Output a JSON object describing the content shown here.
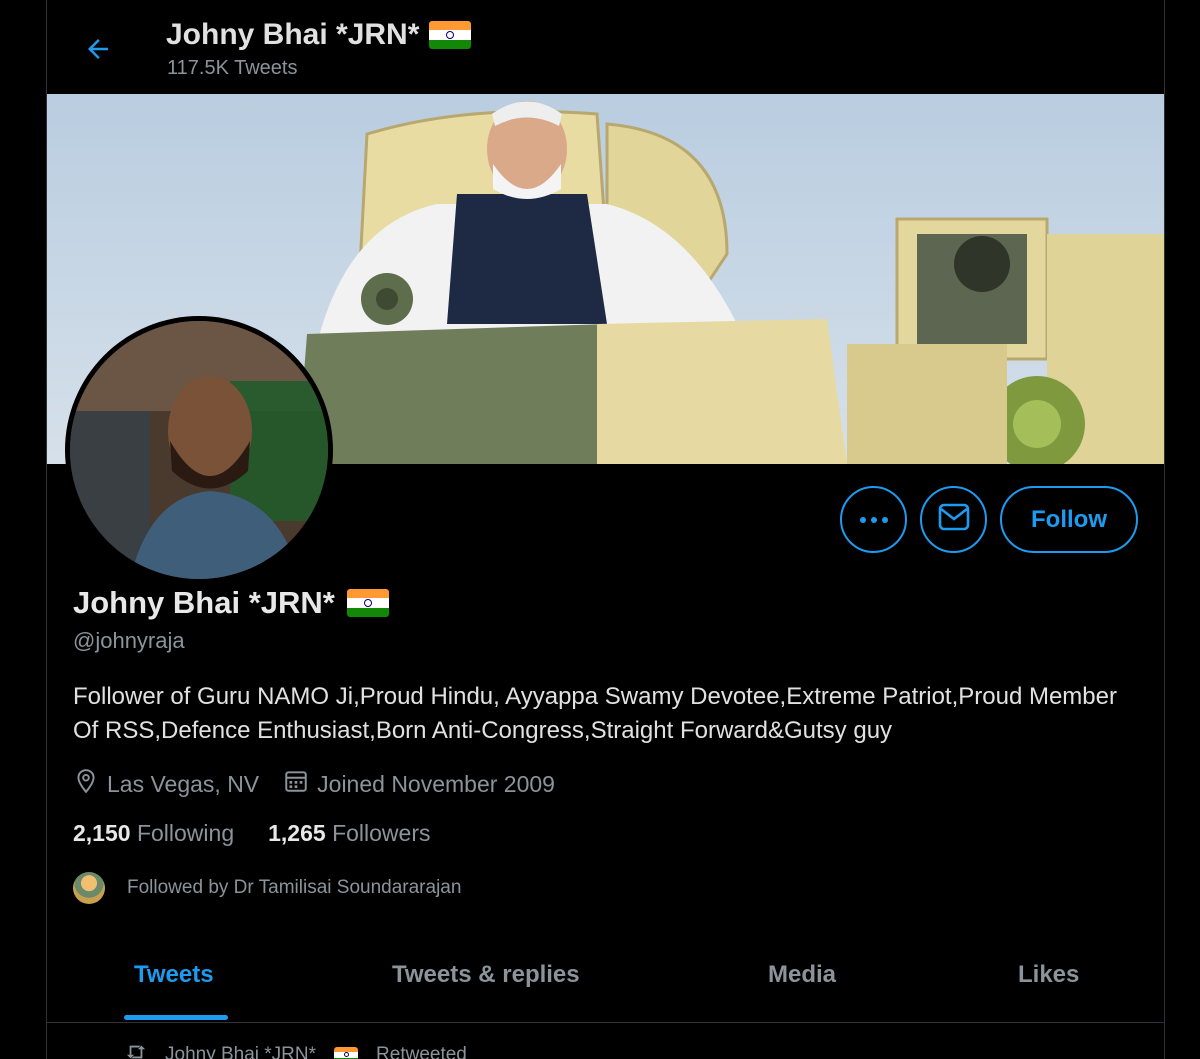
{
  "header": {
    "display_name": "Johny Bhai *JRN*",
    "tweet_count": "117.5K Tweets"
  },
  "profile": {
    "display_name": "Johny Bhai *JRN*",
    "handle": "@johnyraja",
    "bio": "Follower of Guru NAMO Ji,Proud Hindu, Ayyappa Swamy Devotee,Extreme Patriot,Proud Member Of RSS,Defence Enthusiast,Born Anti-Congress,Straight Forward&Gutsy guy",
    "location": "Las Vegas, NV",
    "joined": "Joined November 2009",
    "following_count": "2,150",
    "following_label": "Following",
    "followers_count": "1,265",
    "followers_label": "Followers",
    "followed_by": "Followed by Dr Tamilisai Soundararajan"
  },
  "actions": {
    "follow_label": "Follow"
  },
  "tabs": [
    {
      "label": "Tweets",
      "active": true
    },
    {
      "label": "Tweets & replies",
      "active": false
    },
    {
      "label": "Media",
      "active": false
    },
    {
      "label": "Likes",
      "active": false
    }
  ],
  "first_tweet": {
    "retweet_name": "Johny Bhai *JRN*",
    "retweet_label": "Retweeted"
  },
  "colors": {
    "accent": "#1d9bf0",
    "background": "#000000",
    "secondary_text": "#8b949b"
  },
  "icons": [
    "back-arrow-icon",
    "more-icon",
    "mail-icon",
    "location-icon",
    "calendar-icon",
    "retweet-icon",
    "india-flag-emoji"
  ]
}
